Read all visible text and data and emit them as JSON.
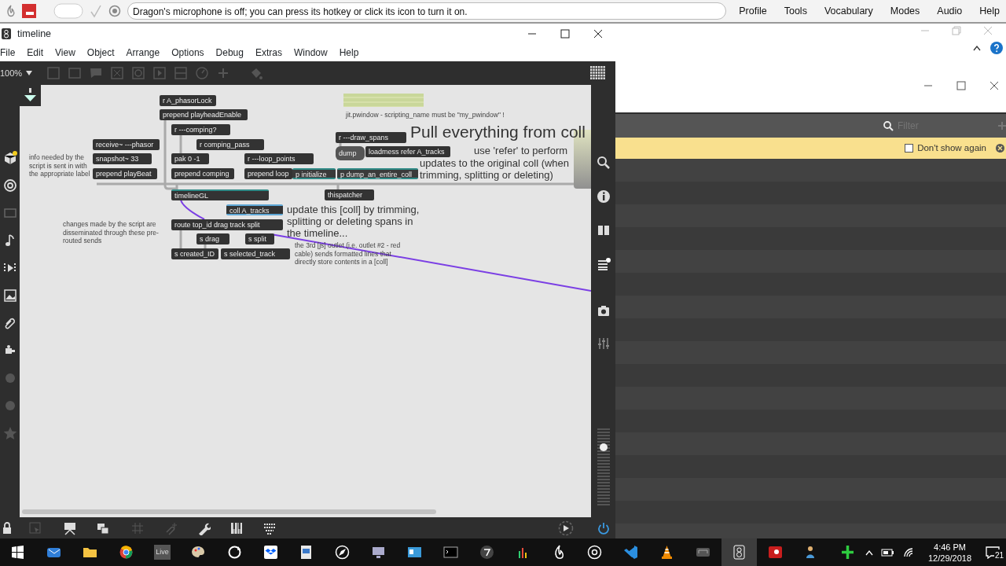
{
  "dragon_bar": {
    "message": "Dragon's microphone is off; you can press its hotkey or click its icon to turn it on.",
    "menu": [
      "Profile",
      "Tools",
      "Vocabulary",
      "Modes",
      "Audio",
      "Help"
    ]
  },
  "window": {
    "title": "timeline",
    "menu": [
      "File",
      "Edit",
      "View",
      "Object",
      "Arrange",
      "Options",
      "Debug",
      "Extras",
      "Window",
      "Help"
    ],
    "zoom": "100%"
  },
  "patcher": {
    "objects": [
      {
        "text": "r A_phasorLock",
        "kind": "object"
      },
      {
        "text": "prepend playheadEnable",
        "kind": "object"
      },
      {
        "text": "r ---comping?",
        "kind": "object"
      },
      {
        "text": "r ---draw_spans",
        "kind": "object"
      },
      {
        "text": "receive~ ---phasor",
        "kind": "object"
      },
      {
        "text": "r comping_pass",
        "kind": "object"
      },
      {
        "text": "dump",
        "kind": "message"
      },
      {
        "text": "loadmess refer A_tracks",
        "kind": "object"
      },
      {
        "text": "snapshot~ 33",
        "kind": "object"
      },
      {
        "text": "pak 0 -1",
        "kind": "object"
      },
      {
        "text": "r ---loop_points",
        "kind": "object"
      },
      {
        "text": "prepend playBeat",
        "kind": "object"
      },
      {
        "text": "prepend comping",
        "kind": "object"
      },
      {
        "text": "prepend loop",
        "kind": "object"
      },
      {
        "text": "p initialize",
        "kind": "subpatcher"
      },
      {
        "text": "p dump_an_entire_coll",
        "kind": "subpatcher"
      },
      {
        "text": "timelineGL",
        "kind": "script"
      },
      {
        "text": "thispatcher",
        "kind": "object"
      },
      {
        "text": "coll A_tracks",
        "kind": "coll"
      },
      {
        "text": "route top_id drag track split",
        "kind": "object"
      },
      {
        "text": "s drag",
        "kind": "object"
      },
      {
        "text": "s split",
        "kind": "object"
      },
      {
        "text": "s created_ID",
        "kind": "object"
      },
      {
        "text": "s selected_track",
        "kind": "object"
      }
    ],
    "comments": [
      {
        "text": "info needed by the script is sent in with the appropriate label",
        "kind": "small"
      },
      {
        "text": "changes made by the script are disseminated through these pre-routed sends",
        "kind": "small"
      },
      {
        "text": "jit.pwindow - scripting_name must be \"my_pwindow\" !",
        "kind": "small"
      },
      {
        "text": "Pull everything from coll",
        "kind": "title"
      },
      {
        "text": "use 'refer' to perform",
        "kind": "medium"
      },
      {
        "text": "updates to the original coll (when trimming, splitting or deleting)",
        "kind": "medium"
      },
      {
        "text": "update this [coll] by trimming, splitting or deleting spans in the timeline...",
        "kind": "medium"
      },
      {
        "text": "the 3rd [js] outlet (i.e. outlet #2 - red cable) sends formatted lines that directly store contents in a [coll]",
        "kind": "small"
      }
    ]
  },
  "volume": {
    "level": 0.76
  },
  "right_panel": {
    "filter": {
      "placeholder": "Filter"
    },
    "notice": {
      "label": "Don't show again",
      "checked": false
    }
  },
  "taskbar": {
    "live_label": "Live",
    "time": "4:46 PM",
    "date": "12/29/2018",
    "notifications": "21"
  }
}
